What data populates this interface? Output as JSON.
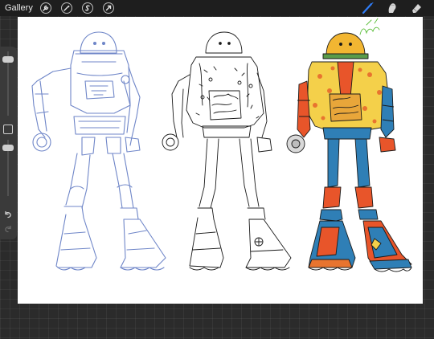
{
  "topbar": {
    "gallery_label": "Gallery",
    "left_tools": [
      "wrench-icon",
      "magic-wand-icon",
      "selection-s-icon",
      "transform-arrow-icon"
    ],
    "right_tools": [
      "brush-icon",
      "smudge-icon",
      "eraser-icon"
    ],
    "active_tool": "brush-icon",
    "active_color": "#2f7cf6"
  },
  "sidebar": {
    "controls": [
      "brush-size-slider",
      "modify-button",
      "brush-opacity-slider",
      "undo-icon",
      "redo-icon"
    ]
  },
  "canvas": {
    "background": "#ffffff",
    "figures": [
      "blue-sketch-robot",
      "lineart-robot",
      "colored-robot"
    ],
    "colors": {
      "sketch_line": "#6f86c8",
      "ink_line": "#1a1a1a",
      "helmet": "#f2b632",
      "jacket": "#f4d04a",
      "pattern": "#e8742f",
      "body_blue": "#2f7fb6",
      "limb_orange": "#e8552a",
      "signature": "#5bbd3a"
    }
  }
}
